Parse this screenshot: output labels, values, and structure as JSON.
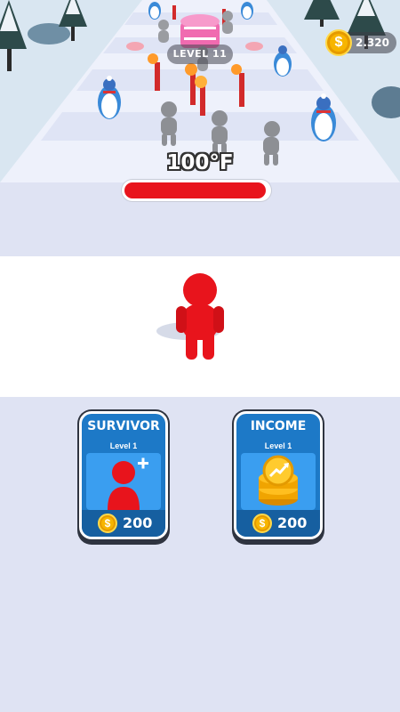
{
  "hud": {
    "level_label": "LEVEL 11",
    "coins": "2.320",
    "coin_symbol": "$"
  },
  "enemy": {
    "temperature": "100°F",
    "heat_level": 0.98
  },
  "upgrades": [
    {
      "title": "SURVIVOR",
      "level": "Level 1",
      "price": "200",
      "icon": "red-stickman-plus-icon"
    },
    {
      "title": "INCOME",
      "level": "Level 1",
      "price": "200",
      "icon": "coin-stack-chart-icon"
    }
  ],
  "colors": {
    "player": "#e8141c",
    "heat_bar": "#e8141c",
    "card_blue": "#1d79c7",
    "card_footer": "#165fa0",
    "coin_gold": "#f7b500",
    "snow_track": "#eef1fb",
    "floor": "#dfe3f3"
  }
}
